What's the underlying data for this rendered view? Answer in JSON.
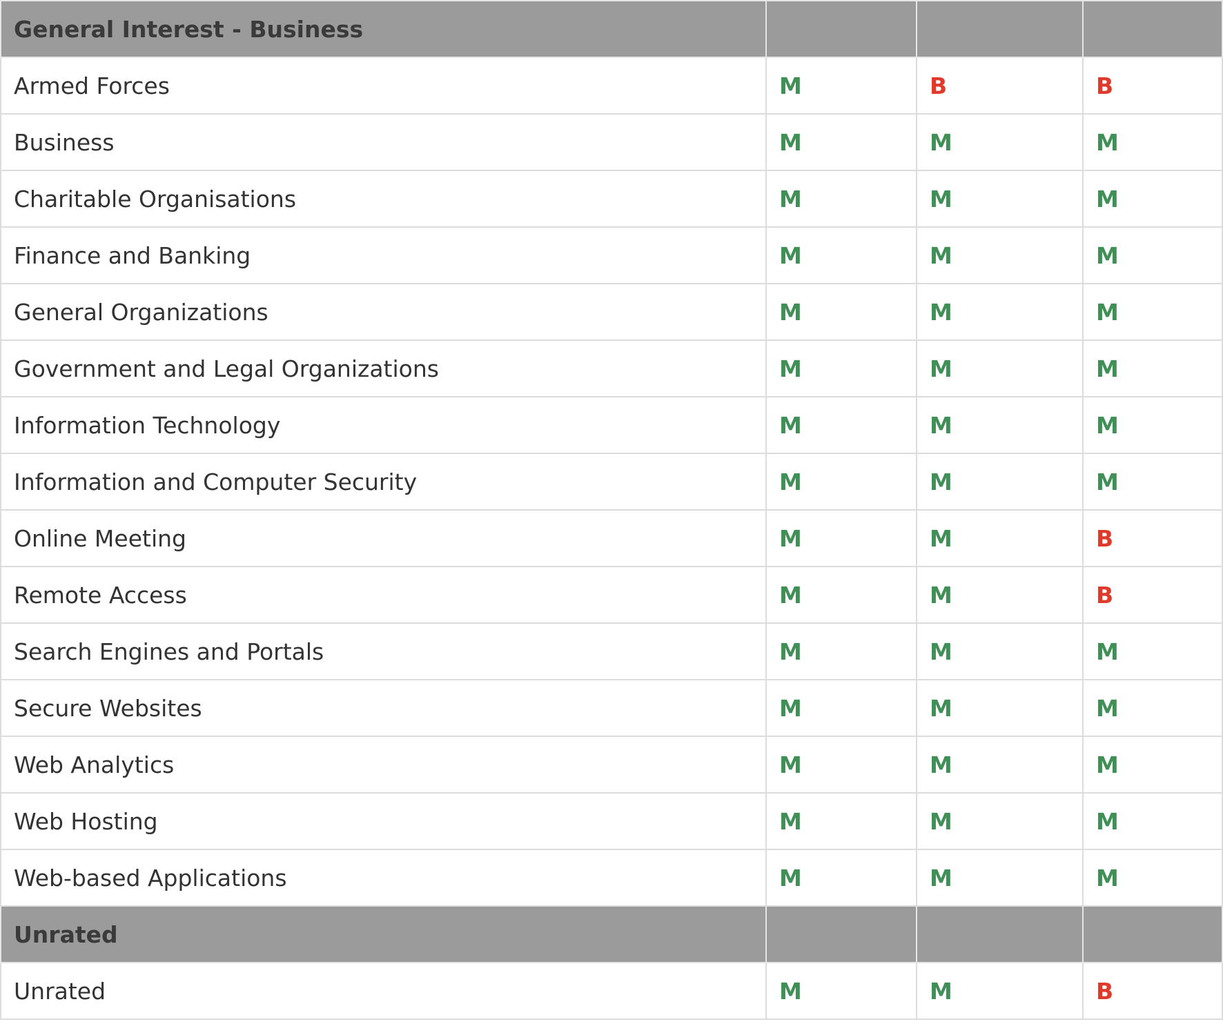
{
  "colors": {
    "section_bg": "#9b9b9b",
    "grid": "#dcdcdc",
    "text": "#333333",
    "rating_m": "#3f8f56",
    "rating_b": "#e03a2c"
  },
  "sections": [
    {
      "title": "General Interest - Business",
      "rows": [
        {
          "name": "Armed Forces",
          "ratings": [
            "M",
            "B",
            "B"
          ]
        },
        {
          "name": "Business",
          "ratings": [
            "M",
            "M",
            "M"
          ]
        },
        {
          "name": "Charitable Organisations",
          "ratings": [
            "M",
            "M",
            "M"
          ]
        },
        {
          "name": "Finance and Banking",
          "ratings": [
            "M",
            "M",
            "M"
          ]
        },
        {
          "name": "General Organizations",
          "ratings": [
            "M",
            "M",
            "M"
          ]
        },
        {
          "name": "Government and Legal Organizations",
          "ratings": [
            "M",
            "M",
            "M"
          ]
        },
        {
          "name": "Information Technology",
          "ratings": [
            "M",
            "M",
            "M"
          ]
        },
        {
          "name": "Information and Computer Security",
          "ratings": [
            "M",
            "M",
            "M"
          ]
        },
        {
          "name": "Online Meeting",
          "ratings": [
            "M",
            "M",
            "B"
          ]
        },
        {
          "name": "Remote Access",
          "ratings": [
            "M",
            "M",
            "B"
          ]
        },
        {
          "name": "Search Engines and Portals",
          "ratings": [
            "M",
            "M",
            "M"
          ]
        },
        {
          "name": "Secure Websites",
          "ratings": [
            "M",
            "M",
            "M"
          ]
        },
        {
          "name": "Web Analytics",
          "ratings": [
            "M",
            "M",
            "M"
          ]
        },
        {
          "name": "Web Hosting",
          "ratings": [
            "M",
            "M",
            "M"
          ]
        },
        {
          "name": "Web-based Applications",
          "ratings": [
            "M",
            "M",
            "M"
          ]
        }
      ]
    },
    {
      "title": "Unrated",
      "rows": [
        {
          "name": "Unrated",
          "ratings": [
            "M",
            "M",
            "B"
          ]
        }
      ]
    }
  ]
}
